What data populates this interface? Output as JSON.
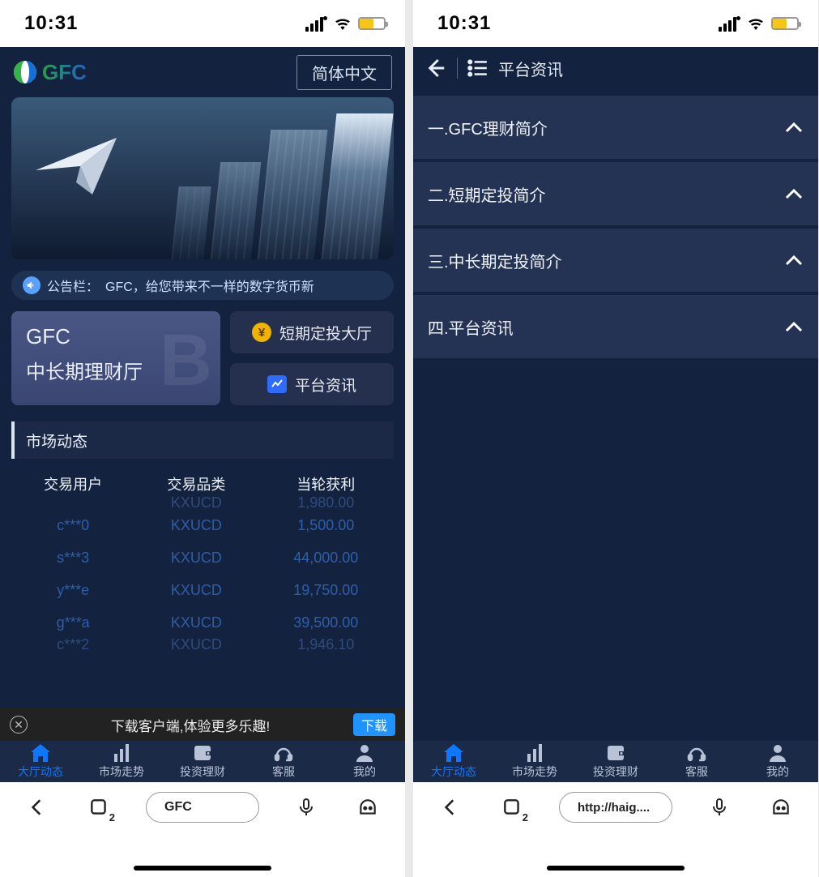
{
  "status_time": "10:31",
  "left": {
    "brand": "GFC",
    "lang_button": "简体中文",
    "notice_label": "公告栏：",
    "notice_text": "GFC，给您带来不一样的数字货币新",
    "big_card_line1": "GFC",
    "big_card_line2": "中长期理财厅",
    "small_card_1": "短期定投大厅",
    "small_card_2": "平台资讯",
    "section_title": "市场动态",
    "columns": {
      "c1": "交易用户",
      "c2": "交易品类",
      "c3": "当轮获利"
    },
    "rows_cut_top": {
      "user": "",
      "prod": "KXUCD",
      "amt": "1,980.00"
    },
    "rows": [
      {
        "user": "c***0",
        "prod": "KXUCD",
        "amt": "1,500.00"
      },
      {
        "user": "s***3",
        "prod": "KXUCD",
        "amt": "44,000.00"
      },
      {
        "user": "y***e",
        "prod": "KXUCD",
        "amt": "19,750.00"
      },
      {
        "user": "g***a",
        "prod": "KXUCD",
        "amt": "39,500.00"
      }
    ],
    "rows_cut_bottom": {
      "user": "c***2",
      "prod": "KXUCD",
      "amt": "1,946.10"
    },
    "download_text": "下载客户端,体验更多乐趣!",
    "download_btn": "下载",
    "omnibox": "GFC"
  },
  "right": {
    "title": "平台资讯",
    "items": [
      "一.GFC理财简介",
      "二.短期定投简介",
      "三.中长期定投简介",
      "四.平台资讯"
    ],
    "omnibox": "http://haig...."
  },
  "nav": {
    "items": [
      {
        "label": "大厅动态",
        "icon": "home"
      },
      {
        "label": "市场走势",
        "icon": "bars"
      },
      {
        "label": "投资理财",
        "icon": "wallet"
      },
      {
        "label": "客服",
        "icon": "headset"
      },
      {
        "label": "我的",
        "icon": "user"
      }
    ],
    "active_index": 0
  },
  "browser_tab_count": "2"
}
